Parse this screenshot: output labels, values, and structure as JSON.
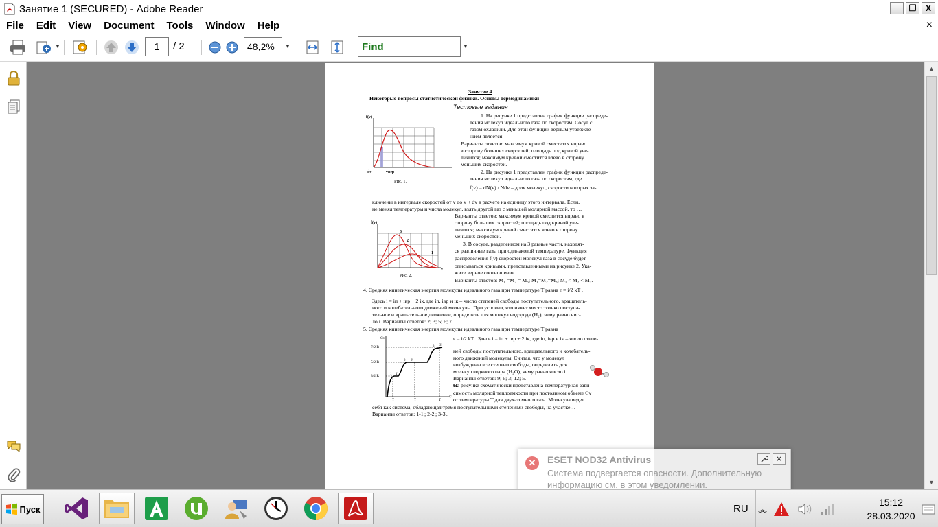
{
  "window": {
    "title": "Занятие 1 (SECURED) - Adobe Reader",
    "minimize": "_",
    "restore": "❐",
    "close": "X"
  },
  "menu": {
    "items": [
      "File",
      "Edit",
      "View",
      "Document",
      "Tools",
      "Window",
      "Help"
    ],
    "close": "×"
  },
  "toolbar": {
    "page_current": "1",
    "page_total": "/ 2",
    "zoom": "48,2%",
    "find": "Find"
  },
  "document": {
    "heading": "Занятие 4",
    "subheading": "Некоторые вопросы статистической физики.  Основы термодинамики",
    "section": "Тестовые задания",
    "fig1_caption": "Рис. 1.",
    "fig2_caption": "Рис. 2.",
    "fig1_ylabel": "f(v)",
    "fig1_xlabel1": "dv",
    "fig1_xlabel2": "vвер",
    "fig2_ylabel": "f(v)",
    "fig2_xlabel": "v",
    "fig2_c1": "1",
    "fig2_c2": "2",
    "fig2_c3": "3",
    "fig3_ylabel": "Cv",
    "fig3_t1": "7/2 R",
    "fig3_t2": "5/2 R",
    "fig3_t3": "3/2 R",
    "fig3_t4": "T",
    "lines": [
      "1.  На рисунке 1 представлен график функции распреде-",
      "ления молекул идеального газа по скоростям. Сосуд с",
      "газом охладили. Для этой функции верным утвержде-",
      "нием является:",
      "Варианты ответов:   максимум кривой сместится вправо",
      "в сторону больших скоростей;  площадь под кривой уве-",
      "личится;   максимум кривой сместится влево в сторону",
      "меньших скоростей.",
      "2.  На рисунке 1 представлен график функции распреде-",
      "ления молекул идеального газа по скоростям, где",
      "f(v) = dN(v) / Ndv  – доля молекул, скорости которых за-",
      "ключены в интервале скоростей от  v  до  v + dv  в расчете на единицу этого интервала. Если,",
      "не меняя температуры и числа молекул, взять другой газ с меньшей молярной массой, то …",
      "Варианты ответов:   максимум кривой сместится вправо в",
      "сторону больших скоростей;  площадь под кривой уве-",
      "личится;   максимум кривой сместится влево в сторону",
      "меньших скоростей.",
      "3.        В сосуде, разделенном на 3 равные части, находят-",
      "ся различные газы при одинаковой температуре.  Функция",
      "распределения f(v) скоростей молекул газа в сосуде будет",
      "описываться кривыми, представленными на рисунке 2. Ука-",
      "жите верное соотношение.",
      "Варианты ответов:   M₁ =M₂ = M₃;  M₁=M₂=M₃;  M₁ < M₂ < M₃.",
      "4.   Средняя кинетическая энергия молекулы идеального газа при температуре  T равна  ε = i/2 kT .",
      "Здесь i = iп + iвр + 2 iк, где iп,   iвр и iк – число степеней свободы поступательного, вращатель-",
      "ного и колебательного движений молекулы. При условии, что имеет место только поступа-",
      "тельное и вращательное движение, определить для молекул водорода (H₂), чему равно  чис-",
      "ло i. Варианты ответов:  2; 3; 5;  6; 7.",
      "5.   Средняя   кинетическая   энергия   молекулы   идеального   газа   при   температуре   T  равна",
      "ε = i/2 kT . Здесь i = iп + iвр + 2 iк, где iп, iвр и  iк – число степе-",
      "ней свободы поступательного, вращательного и колебатель-",
      "ного движений молекулы. Считая, что у  молекул",
      "возбуждены все степени свободы, определить для",
      "молекул водяного пара (H₂O), чему равно  число i.",
      "Варианты ответов:  9;  6;  3;  12;  5.",
      "6.",
      "На рисунке схематически представлена температурная зави-",
      "симость молярной теплоемкости при постоянном объеме Cv",
      "от температуры T для двухатомного газа. Молекула ведет",
      "себя как система, обладающая тремя поступательными степенями свободы,  на участке…",
      "Варианты ответов:  1-1';  2-2';  3-3'."
    ]
  },
  "notification": {
    "title": "ESET NOD32 Antivirus",
    "text": "Система подвергается опасности. Дополнительную информацию см. в этом уведомлении.",
    "icon": "error-icon"
  },
  "taskbar": {
    "start": "Пуск",
    "apps": [
      "visual-studio-icon",
      "file-explorer-icon",
      "a-app-icon",
      "utorrent-icon",
      "user-admin-icon",
      "clock-app-icon",
      "chrome-icon",
      "adobe-reader-icon"
    ],
    "language": "RU",
    "time": "15:12",
    "date": "28.03.2020"
  }
}
